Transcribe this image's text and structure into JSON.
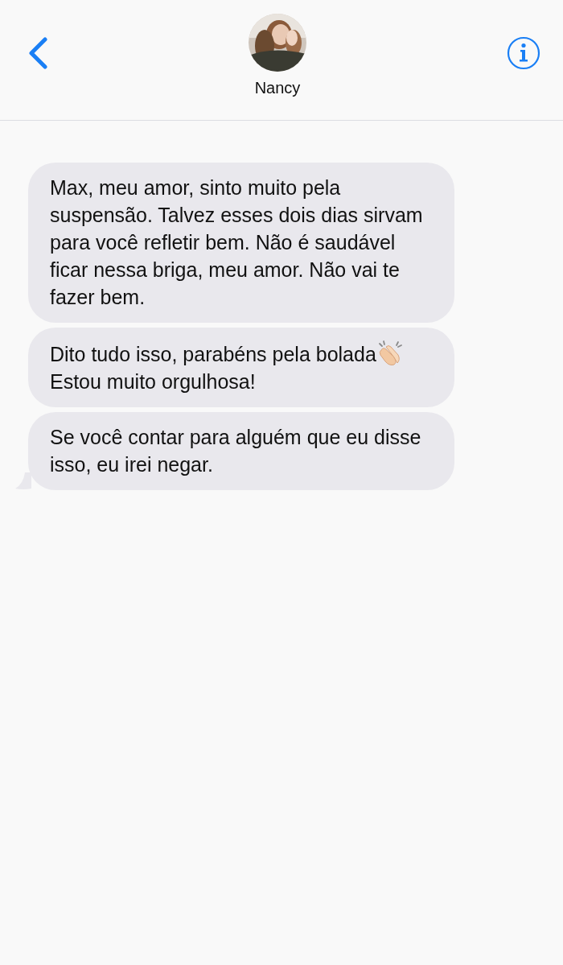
{
  "header": {
    "contact_name": "Nancy"
  },
  "messages": [
    {
      "parts": [
        {
          "kind": "text",
          "text": "Max, meu amor, sinto muito pela suspensão. Talvez esses dois dias sirvam para você refletir bem. Não é saudável ficar nessa briga, meu amor. Não vai te fazer bem."
        }
      ]
    },
    {
      "parts": [
        {
          "kind": "text",
          "text": "Dito tudo isso, parabéns pela bolada"
        },
        {
          "kind": "emoji"
        },
        {
          "kind": "text",
          "text": "Estou muito orgulhosa!"
        }
      ]
    },
    {
      "parts": [
        {
          "kind": "text",
          "text": "Se você contar para alguém que eu disse isso, eu irei negar."
        }
      ]
    }
  ]
}
